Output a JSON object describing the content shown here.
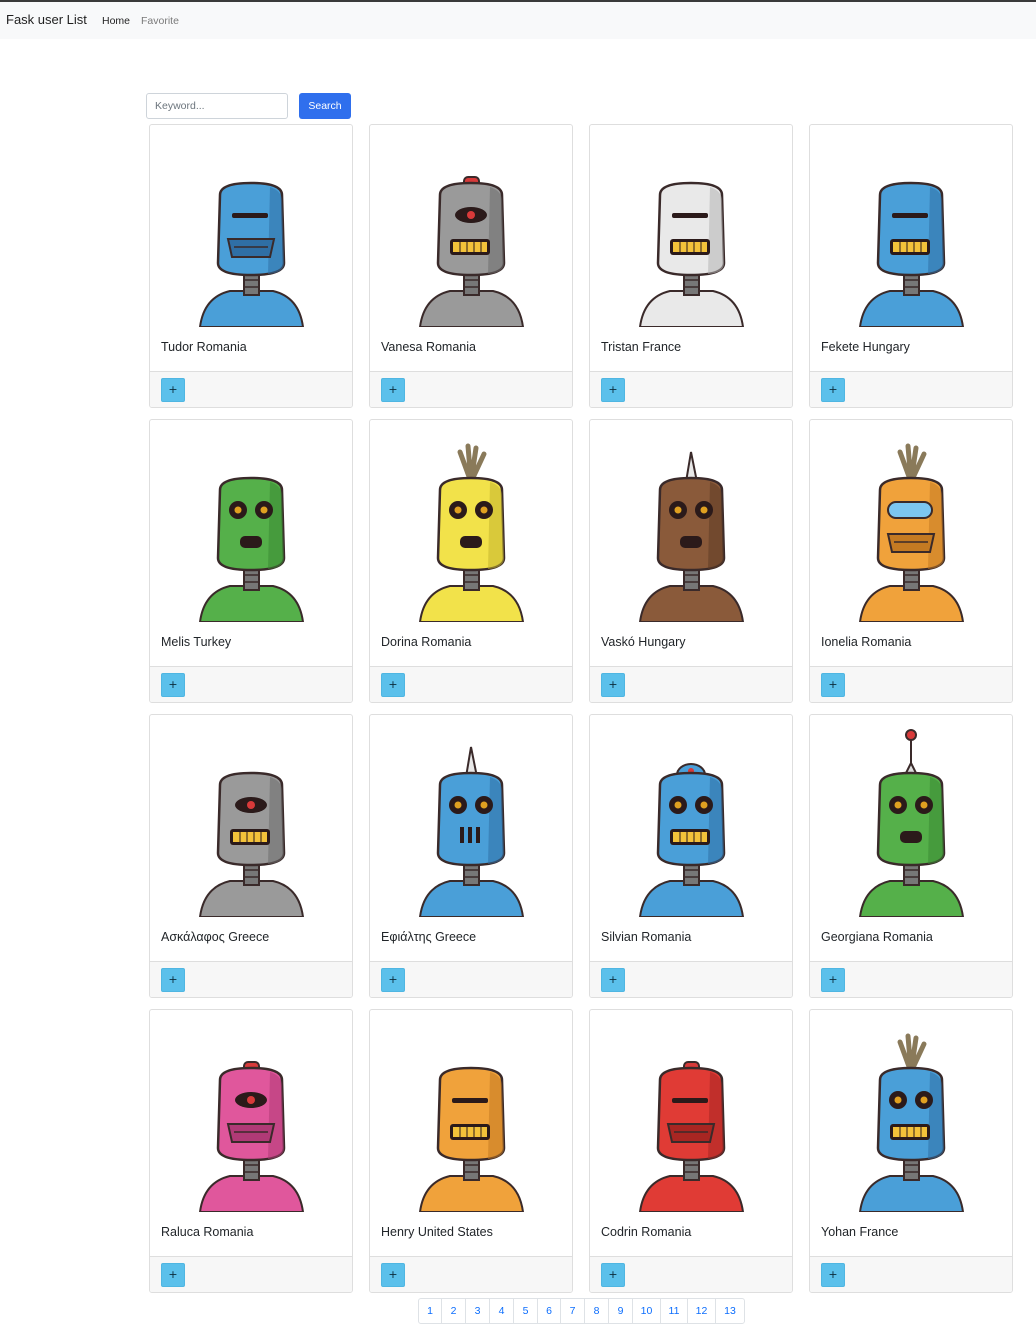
{
  "navbar": {
    "brand": "Fask user List",
    "links": [
      {
        "label": "Home"
      },
      {
        "label": "Favorite"
      }
    ]
  },
  "search": {
    "placeholder": "Keyword...",
    "button_label": "Search"
  },
  "cards": [
    {
      "name": "Tudor Romania",
      "robot": {
        "color": "#4a9fd8",
        "accent": "#2f6fa5",
        "eye": "visor",
        "mouth": "grate",
        "top": "none"
      }
    },
    {
      "name": "Vanesa Romania",
      "robot": {
        "color": "#9a9a9a",
        "accent": "#6e6e6e",
        "eye": "single",
        "mouth": "teeth",
        "top": "knob"
      }
    },
    {
      "name": "Tristan France",
      "robot": {
        "color": "#e9e9e9",
        "accent": "#b5b5b5",
        "eye": "visor",
        "mouth": "teeth",
        "top": "none"
      }
    },
    {
      "name": "Fekete Hungary",
      "robot": {
        "color": "#4a9fd8",
        "accent": "#2f6fa5",
        "eye": "visor",
        "mouth": "teeth",
        "top": "none"
      }
    },
    {
      "name": "Melis Turkey",
      "robot": {
        "color": "#55b04a",
        "accent": "#3a8a33",
        "eye": "double",
        "mouth": "open",
        "top": "none"
      }
    },
    {
      "name": "Dorina Romania",
      "robot": {
        "color": "#f2e24a",
        "accent": "#c4b52d",
        "eye": "double",
        "mouth": "open",
        "top": "tuft"
      }
    },
    {
      "name": "Vaskó Hungary",
      "robot": {
        "color": "#8a5a3a",
        "accent": "#5f3c25",
        "eye": "double",
        "mouth": "open",
        "top": "spike"
      }
    },
    {
      "name": "Ionelia Romania",
      "robot": {
        "color": "#f0a23b",
        "accent": "#c47a22",
        "eye": "visor-blue",
        "mouth": "grate",
        "top": "tuft"
      }
    },
    {
      "name": "Ασκάλαφος Greece",
      "robot": {
        "color": "#9a9a9a",
        "accent": "#6e6e6e",
        "eye": "single",
        "mouth": "teeth",
        "top": "none"
      }
    },
    {
      "name": "Εφιάλτης Greece",
      "robot": {
        "color": "#4a9fd8",
        "accent": "#2f6fa5",
        "eye": "double",
        "mouth": "bars",
        "top": "spike"
      }
    },
    {
      "name": "Silvian Romania",
      "robot": {
        "color": "#4a9fd8",
        "accent": "#2f6fa5",
        "eye": "double",
        "mouth": "teeth",
        "top": "dome"
      }
    },
    {
      "name": "Georgiana Romania",
      "robot": {
        "color": "#55b04a",
        "accent": "#3a8a33",
        "eye": "double",
        "mouth": "open",
        "top": "antenna"
      }
    },
    {
      "name": "Raluca Romania",
      "robot": {
        "color": "#e0579c",
        "accent": "#b03a76",
        "eye": "single",
        "mouth": "grate",
        "top": "knob"
      }
    },
    {
      "name": "Henry United States",
      "robot": {
        "color": "#f0a23b",
        "accent": "#c47a22",
        "eye": "visor",
        "mouth": "teeth",
        "top": "none"
      }
    },
    {
      "name": "Codrin Romania",
      "robot": {
        "color": "#e03b35",
        "accent": "#a82622",
        "eye": "visor",
        "mouth": "grate",
        "top": "knob"
      }
    },
    {
      "name": "Yohan France",
      "robot": {
        "color": "#4a9fd8",
        "accent": "#2f6fa5",
        "eye": "double",
        "mouth": "teeth",
        "top": "tuft"
      }
    }
  ],
  "card_action_label": "+",
  "pagination": {
    "pages": [
      "1",
      "2",
      "3",
      "4",
      "5",
      "6",
      "7",
      "8",
      "9",
      "10",
      "11",
      "12",
      "13"
    ]
  }
}
